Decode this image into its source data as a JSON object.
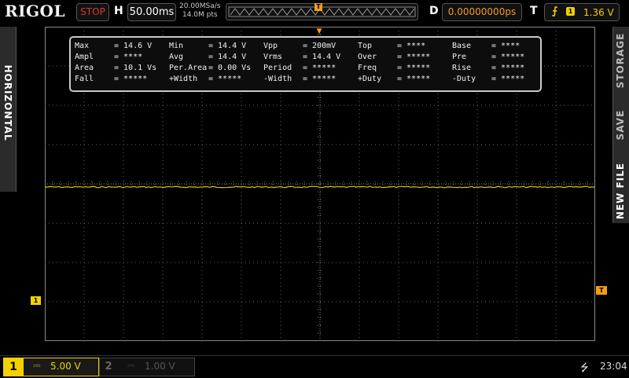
{
  "header": {
    "brand": "RIGOL",
    "run_state": "STOP",
    "h_label": "H",
    "timebase": "50.00ms",
    "sample_rate": "20.00MSa/s",
    "memory_depth": "14.0M pts",
    "trigger_pos_marker": "T",
    "d_label": "D",
    "delay": "0.00000000ps",
    "t_label": "T",
    "trigger_edge_icon": "rising-edge-icon",
    "trigger_source": "1",
    "trigger_level": "1.36 V"
  },
  "side_tabs": {
    "left": "HORIZONTAL",
    "storage": "STORAGE",
    "save": "SAVE",
    "new_file": "NEW FILE"
  },
  "measurements": {
    "rows": [
      [
        [
          "Max",
          "= 14.6 V"
        ],
        [
          "Min",
          "= 14.4 V"
        ],
        [
          "Vpp",
          "= 200mV"
        ],
        [
          "Top",
          "= ****"
        ],
        [
          "Base",
          "= ****"
        ]
      ],
      [
        [
          "Ampl",
          "= ****"
        ],
        [
          "Avg",
          "= 14.4 V"
        ],
        [
          "Vrms",
          "= 14.4 V"
        ],
        [
          "Over",
          "= *****"
        ],
        [
          "Pre",
          "= *****"
        ]
      ],
      [
        [
          "Area",
          "= 10.1 Vs"
        ],
        [
          "Per.Area",
          "= 0.00 Vs"
        ],
        [
          "Period",
          "= *****"
        ],
        [
          "Freq",
          "= *****"
        ],
        [
          "Rise",
          "= *****"
        ]
      ],
      [
        [
          "Fall",
          "= *****"
        ],
        [
          "+Width",
          "= *****"
        ],
        [
          "-Width",
          "= *****"
        ],
        [
          "+Duty",
          "= *****"
        ],
        [
          "-Duty",
          "= *****"
        ]
      ]
    ]
  },
  "markers": {
    "ch1": "1",
    "trigger_level_tag": "T",
    "trigger_top": "▼"
  },
  "channels": {
    "ch1": {
      "num": "1",
      "coupling_icon": "dc-coupling-icon",
      "coupling_glyph": "⎓",
      "scale": "5.00 V",
      "color": "#f5d000"
    },
    "ch2": {
      "num": "2",
      "coupling_glyph": "⎓",
      "scale": "1.00 V",
      "color": "#555555"
    }
  },
  "status": {
    "usb_icon": "usb-icon",
    "usb_glyph": "⭍",
    "time": "23:04"
  },
  "colors": {
    "trace": "#d9c800",
    "grid": "#777777",
    "accent": "#f39c1e"
  }
}
